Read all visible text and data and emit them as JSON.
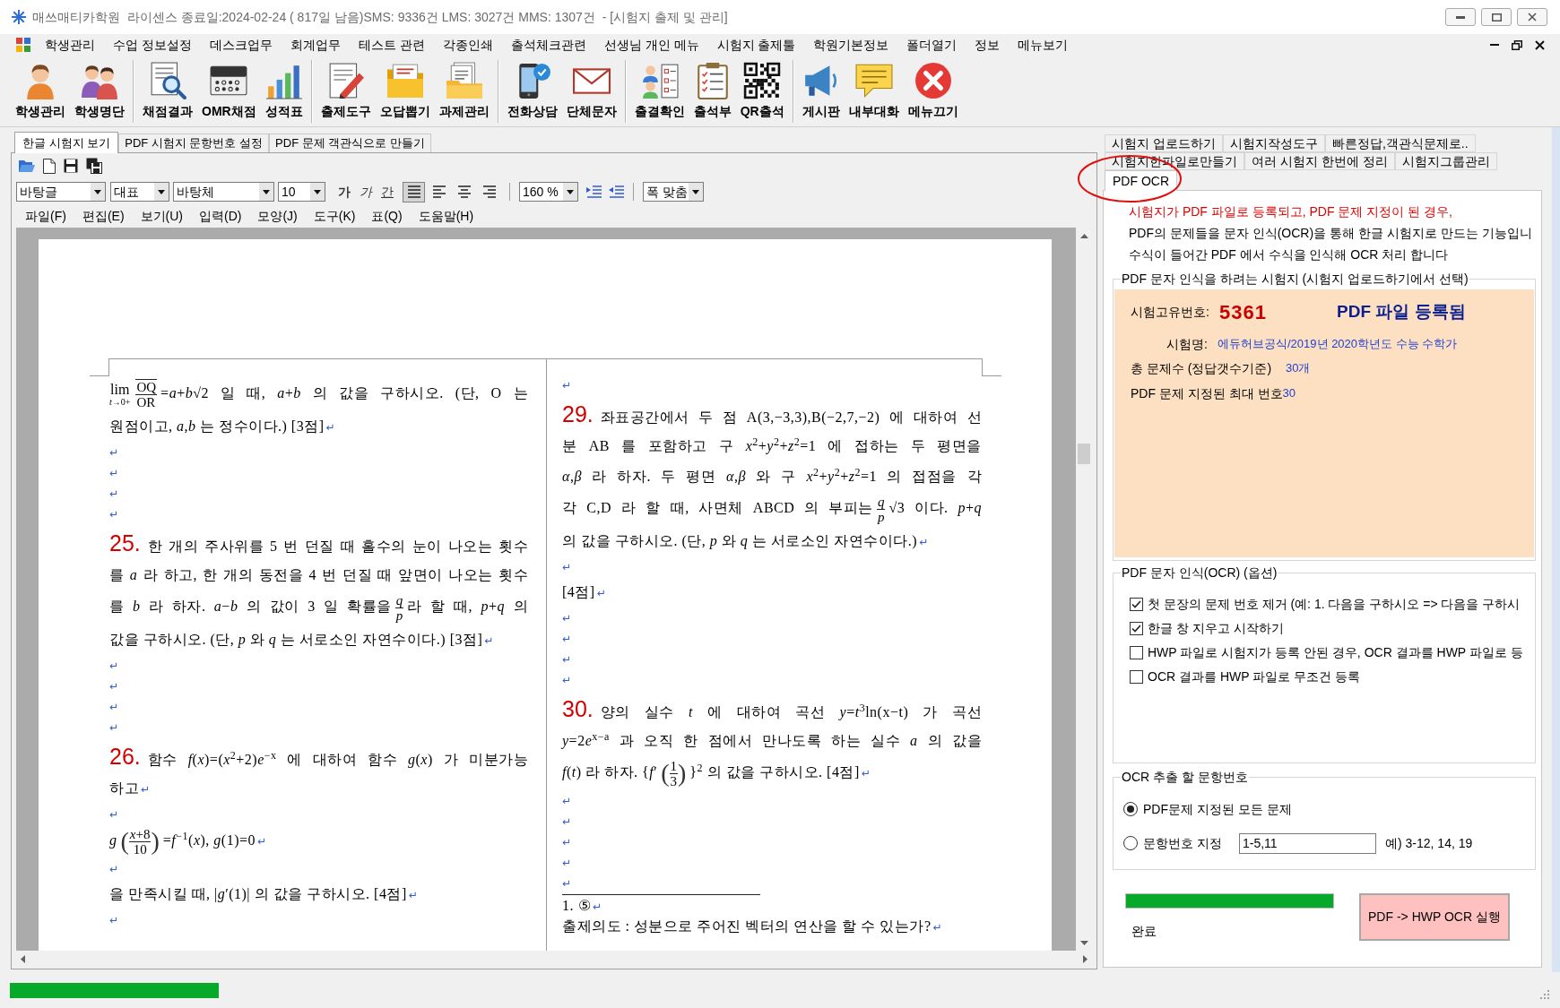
{
  "window": {
    "title": "매쓰매티카학원  라이센스 종료일:2024-02-24 ( 817일 남음)SMS: 9336건 LMS: 3027건 MMS: 1307건  - [시험지 출제 및 관리]"
  },
  "menu": [
    "학생관리",
    "수업 정보설정",
    "데스크업무",
    "회계업무",
    "테스트 관련",
    "각종인쇄",
    "출석체크관련",
    "선생님 개인 메뉴",
    "시험지 출제툴",
    "학원기본정보",
    "폴더열기",
    "정보",
    "메뉴보기"
  ],
  "toolbar": [
    [
      "학생관리",
      "학생명단"
    ],
    [
      "채점결과",
      "OMR채점",
      "성적표"
    ],
    [
      "출제도구",
      "오답뽑기",
      "과제관리"
    ],
    [
      "전화상담",
      "단체문자"
    ],
    [
      "출결확인",
      "출석부",
      "QR출석"
    ],
    [
      "게시판",
      "내부대화",
      "메뉴끄기"
    ]
  ],
  "editor": {
    "tabs": [
      {
        "label": "한글 시험지 보기",
        "selected": true
      },
      {
        "label": "PDF 시험지 문항번호 설정",
        "selected": false
      },
      {
        "label": "PDF 문제 객관식으로 만들기",
        "selected": false
      }
    ],
    "format_bar": {
      "style": "바탕글",
      "script": "대표",
      "font": "바탕체",
      "size": "10",
      "char_buttons": [
        {
          "kind": "bold",
          "text": "가"
        },
        {
          "kind": "italic",
          "text": "가"
        },
        {
          "kind": "underline",
          "text": "간"
        }
      ],
      "align": [
        {
          "kind": "justify",
          "selected": true
        },
        {
          "kind": "left",
          "selected": false
        },
        {
          "kind": "center",
          "selected": false
        },
        {
          "kind": "right",
          "selected": false
        }
      ],
      "zoom": "160 %",
      "fit": "폭 맞춤"
    },
    "menu": [
      "파일(F)",
      "편집(E)",
      "보기(U)",
      "입력(D)",
      "모양(J)",
      "도구(K)",
      "표(Q)",
      "도움말(H)"
    ],
    "document": {
      "columns": [
        {
          "lines": [
            [
              {
                "kind": "limit",
                "text": "lim",
                "sub": "*t*→0+"
              },
              {
                "kind": "frac",
                "num": "OQ",
                "den": "OR",
                "overline": true
              },
              {
                "kind": "text",
                "text": "=*a*+*b*√2 일 때, *a*+*b* 의 값을 구하시오. (단, O 는"
              }
            ],
            [
              {
                "kind": "text",
                "text": "원점이고, *a*,*b* 는 정수이다.) [3점]"
              },
              {
                "kind": "return",
                "text": "↵"
              }
            ],
            [
              {
                "kind": "return",
                "text": "↵"
              }
            ],
            [
              {
                "kind": "return",
                "text": "↵"
              }
            ],
            [
              {
                "kind": "return",
                "text": "↵"
              }
            ],
            [
              {
                "kind": "return",
                "text": "↵"
              }
            ],
            [
              {
                "kind": "num",
                "text": "25."
              },
              {
                "kind": "text",
                "text": "한 개의 주사위를 5 번 던질 때 홀수의 눈이 나오는 횟수"
              }
            ],
            [
              {
                "kind": "text",
                "text": "를 *a* 라 하고, 한 개의 동전을 4 번 던질 때 앞면이 나오는 횟수"
              }
            ],
            [
              {
                "kind": "text",
                "text": "를 *b* 라 하자. *a*−*b* 의 값이 3 일 확률을"
              },
              {
                "kind": "frac",
                "num": "*q*",
                "den": "*p*"
              },
              {
                "kind": "text",
                "text": "라 할 때, *p*+*q* 의"
              }
            ],
            [
              {
                "kind": "text",
                "text": "값을 구하시오. (단, *p* 와 *q* 는 서로소인 자연수이다.) [3점]"
              },
              {
                "kind": "return",
                "text": "↵"
              }
            ],
            [
              {
                "kind": "return",
                "text": "↵"
              }
            ],
            [
              {
                "kind": "return",
                "text": "↵"
              }
            ],
            [
              {
                "kind": "return",
                "text": "↵"
              }
            ],
            [
              {
                "kind": "return",
                "text": "↵"
              }
            ],
            [
              {
                "kind": "num",
                "text": "26."
              },
              {
                "kind": "text",
                "text": "함수 *f*(*x*)=(*x*$^{2}$+2)*e*$^{−x}$ 에 대하여 함수 *g*(*x*) 가 미분가능"
              }
            ],
            [
              {
                "kind": "text",
                "text": "하고"
              },
              {
                "kind": "return",
                "text": "↵"
              }
            ],
            [
              {
                "kind": "return",
                "text": "↵"
              }
            ],
            [
              {
                "kind": "text",
                "text": "*g*"
              },
              {
                "kind": "frac",
                "num": "*x*+8",
                "den": "10",
                "left": "(",
                "right": ")"
              },
              {
                "kind": "text",
                "text": "=*f*$^{−1}$(*x*), *g*(1)=0"
              },
              {
                "kind": "return",
                "text": "↵"
              }
            ],
            [
              {
                "kind": "return",
                "text": "↵"
              }
            ],
            [
              {
                "kind": "text",
                "text": "을 만족시킬 때, |*g*′(1)| 의 값을 구하시오. [4점]"
              },
              {
                "kind": "return",
                "text": "↵"
              }
            ],
            [
              {
                "kind": "return",
                "text": "↵"
              }
            ]
          ]
        },
        {
          "lines": [
            [
              {
                "kind": "return",
                "text": "↵"
              }
            ],
            [
              {
                "kind": "num",
                "text": "29."
              },
              {
                "kind": "text",
                "text": "좌표공간에서 두 점 A(3,−3,3),B(−2,7,−2) 에 대하여 선"
              }
            ],
            [
              {
                "kind": "text",
                "text": "분 AB 를 포함하고 구 *x*$^{2}$+*y*$^{2}$+*z*$^{2}$=1 에 접하는 두 평면을"
              }
            ],
            [
              {
                "kind": "text",
                "text": "*α*,*β* 라 하자. 두 평면 *α*,*β* 와 구 *x*$^{2}$+*y*$^{2}$+*z*$^{2}$=1 의 접점을 각"
              }
            ],
            [
              {
                "kind": "text",
                "text": "각 C,D 라 할 때, 사면체 ABCD 의 부피는"
              },
              {
                "kind": "frac",
                "num": "*q*",
                "den": "*p*"
              },
              {
                "kind": "text",
                "text": "√3 이다. *p*+*q*"
              }
            ],
            [
              {
                "kind": "text",
                "text": "의 값을 구하시오. (단, *p* 와 *q* 는 서로소인 자연수이다.)"
              },
              {
                "kind": "return",
                "text": "↵"
              }
            ],
            [
              {
                "kind": "return",
                "text": "↵"
              }
            ],
            [
              {
                "kind": "text",
                "text": "[4점]"
              },
              {
                "kind": "return",
                "text": "↵"
              }
            ],
            [
              {
                "kind": "return",
                "text": "↵"
              }
            ],
            [
              {
                "kind": "return",
                "text": "↵"
              }
            ],
            [
              {
                "kind": "return",
                "text": "↵"
              }
            ],
            [
              {
                "kind": "return",
                "text": "↵"
              }
            ],
            [
              {
                "kind": "num",
                "text": "30."
              },
              {
                "kind": "text",
                "text": "양의 실수 *t* 에 대하여 곡선 *y*=*t*$^{3}$ln(x−t) 가 곡선"
              }
            ],
            [
              {
                "kind": "text",
                "text": "*y*=2"
              },
              {
                "kind": "text",
                "text": "*e*$^{x−a}$ 과 오직 한 점에서 만나도록 하는 실수 *a* 의 값을"
              }
            ],
            [
              {
                "kind": "text",
                "text": "*f*(*t*) 라 하자. {*f*′"
              },
              {
                "kind": "frac",
                "num": "1",
                "den": "3",
                "left": "(",
                "right": ")"
              },
              {
                "kind": "text",
                "text": "}$^{2}$ 의 값을 구하시오. [4점]"
              },
              {
                "kind": "return",
                "text": "↵"
              }
            ],
            [
              {
                "kind": "return",
                "text": "↵"
              }
            ],
            [
              {
                "kind": "return",
                "text": "↵"
              }
            ],
            [
              {
                "kind": "return",
                "text": "↵"
              }
            ],
            [
              {
                "kind": "return",
                "text": "↵"
              }
            ],
            [
              {
                "kind": "return",
                "text": "↵"
              }
            ]
          ],
          "footnotes": [
            [
              {
                "kind": "text",
                "text": "1. ⑤"
              },
              {
                "kind": "return",
                "text": "↵"
              }
            ],
            [
              {
                "kind": "text",
                "text": "출제의도 : 성분으로 주어진 벡터의 연산을 할 수 있는가?"
              },
              {
                "kind": "return",
                "text": "↵"
              }
            ]
          ]
        }
      ]
    }
  },
  "panel": {
    "tab_rows": [
      [
        {
          "label": "시험지 업로드하기",
          "selected": false
        },
        {
          "label": "시험지작성도구",
          "selected": false
        },
        {
          "label": "빠른정답,객관식문제로..",
          "selected": false
        }
      ],
      [
        {
          "label": "시험지한파일로만들기",
          "selected": false
        },
        {
          "label": "여러 시험지 한번에 정리",
          "selected": false
        },
        {
          "label": "시험지그룹관리",
          "selected": false
        }
      ],
      [
        {
          "label": "PDF OCR",
          "selected": true
        }
      ]
    ],
    "notice": "시험지가 PDF 파일로 등록되고, PDF 문제 지정이 된 경우,",
    "description": [
      "PDF의 문제들을 문자 인식(OCR)을 통해 한글 시험지로 만드는 기능입니",
      "수식이 들어간 PDF 에서 수식을 인식해 OCR 처리 합니다"
    ],
    "exam_group": {
      "title": "PDF 문자 인식을 하려는 시험지 (시험지 업로드하기에서 선택)",
      "id_label": "시험고유번호:",
      "id": "5361",
      "status": "PDF 파일 등록됨",
      "name_label": "시험명:",
      "name": "에듀허브공식/2019년 2020학년도 수능 수학가",
      "count_label": "총 문제수 (정답갯수기준)",
      "count": "30개",
      "max_label": "PDF 문제 지정된 최대 번호",
      "max": "30"
    },
    "options_group": {
      "title": "PDF 문자 인식(OCR) (옵션)",
      "options": [
        {
          "label": "첫 문장의 문제 번호 제거 (예: 1. 다음을 구하시오 => 다음을 구하시",
          "checked": true
        },
        {
          "label": "한글 창 지우고 시작하기",
          "checked": true
        },
        {
          "label": "HWP 파일로 시험지가 등록 안된 경우, OCR 결과를 HWP 파일로 등",
          "checked": false
        },
        {
          "label": "OCR 결과를 HWP 파일로 무조건 등록",
          "checked": false
        }
      ]
    },
    "range_group": {
      "title": "OCR 추출 할 문항번호",
      "choices": [
        {
          "label": "PDF문제 지정된 모든 문제",
          "selected": true
        },
        {
          "label": "문항번호 지정",
          "selected": false
        }
      ],
      "range": "1-5,11",
      "hint": "예) 3-12, 14, 19"
    },
    "progress": {
      "level": 1,
      "status": "완료"
    },
    "run_button": "PDF -> HWP OCR 실행"
  },
  "status_bar": {
    "progress": {
      "level": 1
    }
  }
}
